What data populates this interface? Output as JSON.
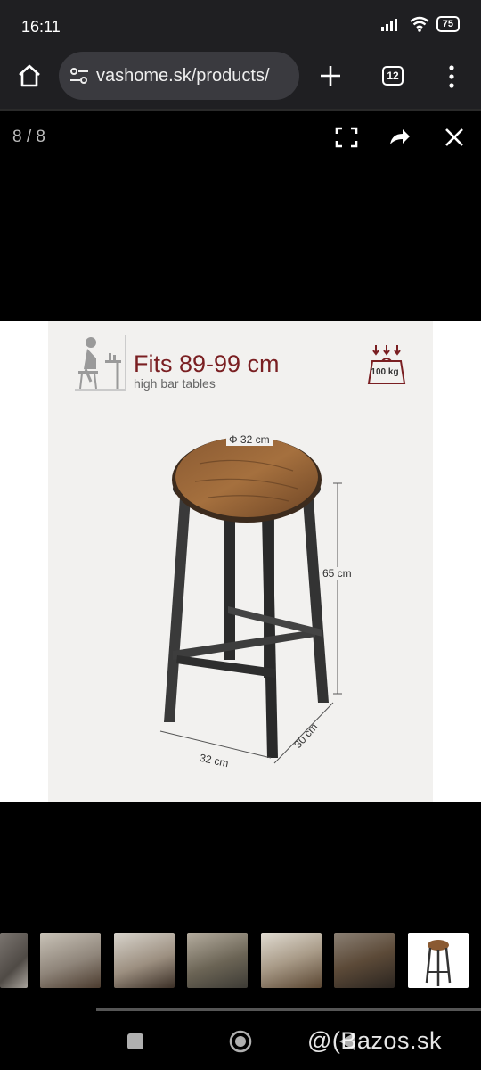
{
  "status_bar": {
    "time": "16:11",
    "battery": "75"
  },
  "browser": {
    "url": "vashome.sk/products/",
    "tab_count": "12"
  },
  "viewer": {
    "counter": "8 / 8"
  },
  "product_image": {
    "headline": "Fits 89-99 cm",
    "subline": "high bar tables",
    "weight_badge": "100 kg",
    "dim_seat_diameter": "Φ 32 cm",
    "dim_height": "65 cm",
    "dim_width": "32 cm",
    "dim_depth": "30 cm"
  },
  "thumbnails": {
    "count": 7,
    "active_index": 6
  },
  "watermark": "@(Bazos.sk"
}
